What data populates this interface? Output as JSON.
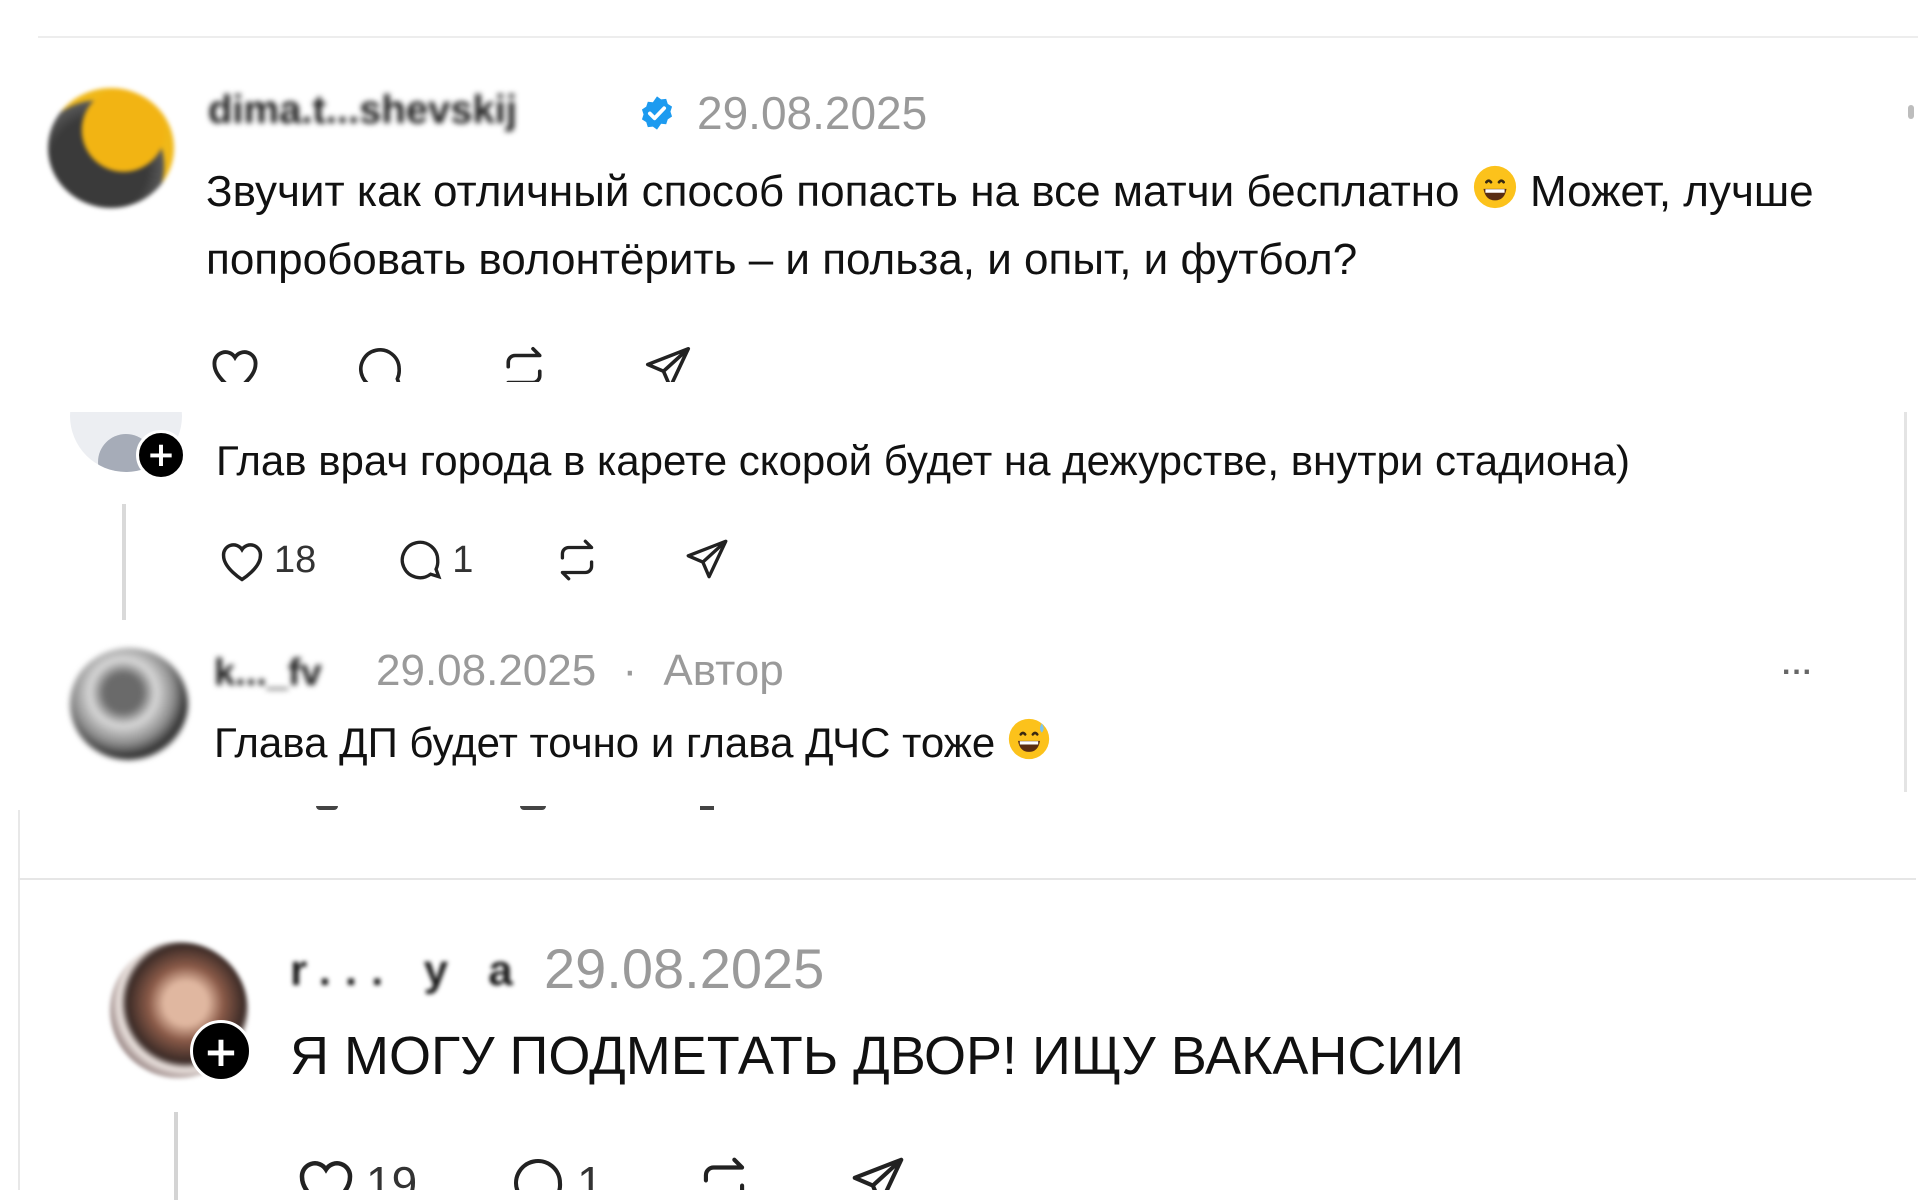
{
  "post1": {
    "username": "dima.t...shevskij",
    "date": "29.08.2025",
    "text_part1": "Звучит как отличный способ попасть на все матчи бесплатно",
    "emoji": "grinning-face",
    "text_part2": "Может, лучше попробовать волонтёрить – и польза, и опыт, и футбол?"
  },
  "reply1": {
    "text": "Глав врач города в карете скорой будет на дежурстве, внутри стадиона)",
    "likes": "18",
    "comments": "1"
  },
  "reply2": {
    "username": "k..._fv",
    "date": "29.08.2025",
    "separator": "·",
    "author_badge": "Автор",
    "text": "Глава ДП будет точно и глава ДЧС тоже",
    "emoji": "grinning-face-with-sweat",
    "more": "..."
  },
  "post2": {
    "username": "r... y a",
    "date": "29.08.2025",
    "text": "Я МОГУ ПОДМЕТАТЬ ДВОР! ИЩУ ВАКАНСИИ",
    "likes": "19",
    "comments": "1"
  },
  "colors": {
    "verified": "#1d9bf0",
    "date": "#9a9a9a",
    "text": "#111111",
    "divider": "#e6e6e6"
  }
}
